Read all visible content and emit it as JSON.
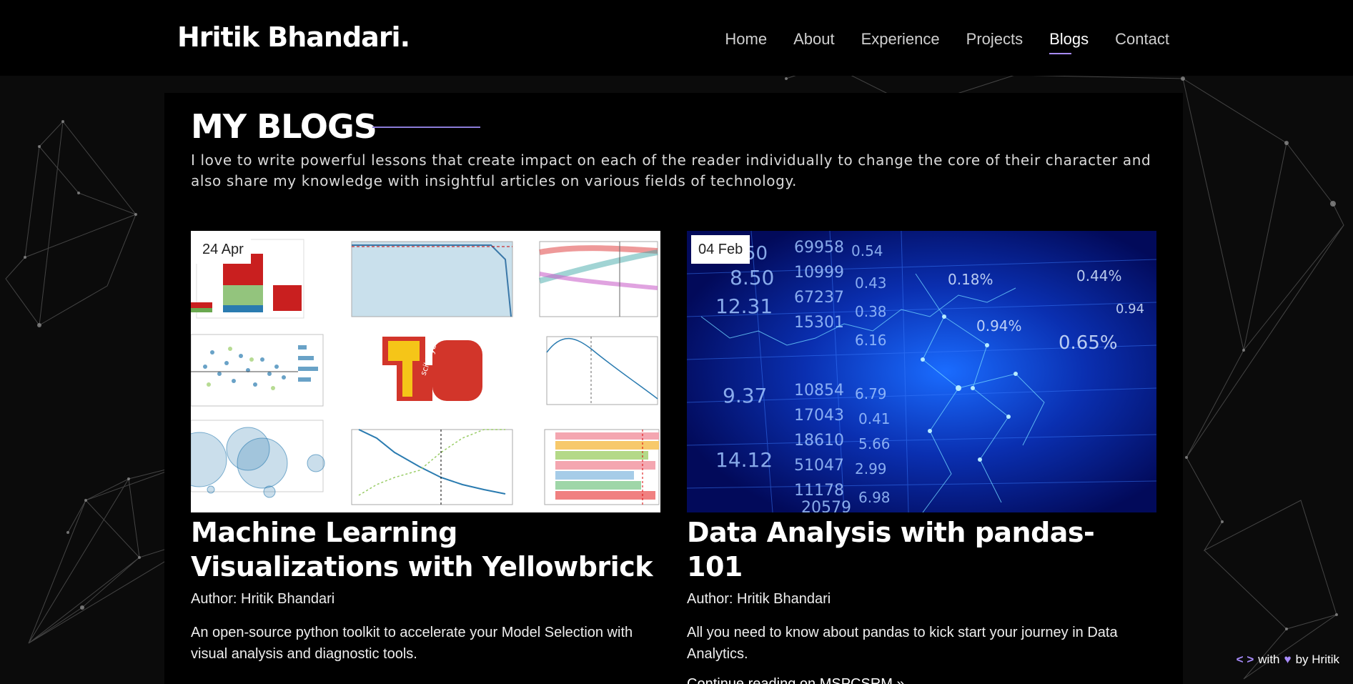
{
  "brand": "Hritik Bhandari.",
  "nav": {
    "items": [
      "Home",
      "About",
      "Experience",
      "Projects",
      "Blogs",
      "Contact"
    ],
    "active": "Blogs"
  },
  "section": {
    "title": "MY BLOGS",
    "intro": "I love to write powerful lessons that create impact on each of the reader individually to change the core of their character and also share my knowledge with insightful articles on various fields of technology."
  },
  "posts": [
    {
      "date": "24 Apr",
      "title": "Machine Learning Visualizations with Yellowbrick",
      "author": "Author: Hritik Bhandari",
      "description": "An open-source python toolkit to accelerate your Model Selection with visual analysis and diagnostic tools.",
      "thumb_logo": "scikit-yb.org"
    },
    {
      "date": "04 Feb",
      "title": "Data Analysis with pandas- 101",
      "author": "Author: Hritik Bhandari",
      "description": "All you need to know about pandas to kick start your journey in Data Analytics.",
      "link": "Continue reading on MSPCSRM »",
      "ticker_numbers": [
        "50",
        "69958",
        "0.54",
        "8.50",
        "10999",
        "0.43",
        "12.31",
        "67237",
        "0.38",
        "0.18%",
        "0.44%",
        "0.94%",
        "0.65%",
        "15301",
        "6.16",
        "10854",
        "6.79",
        "17043",
        "0.41",
        "18610",
        "5.66",
        "51047",
        "2.99",
        "11178",
        "6.98",
        "20579",
        "9.37",
        "14.12",
        "0.94"
      ]
    }
  ],
  "footer": {
    "with": "with",
    "by": "by Hritik"
  },
  "colors": {
    "accent": "#a78bfa",
    "background": "#0b0b0b",
    "panel": "#000000"
  }
}
